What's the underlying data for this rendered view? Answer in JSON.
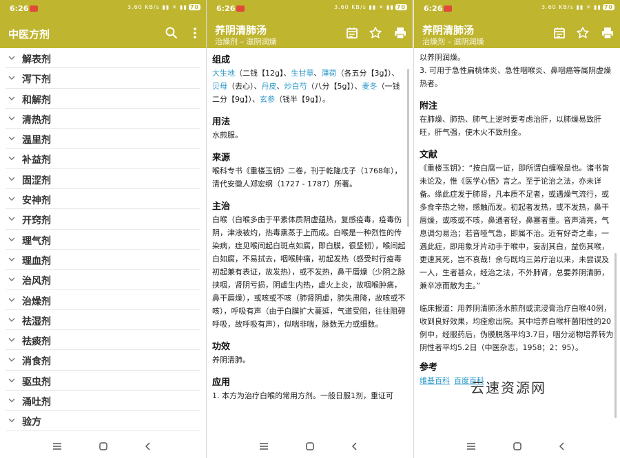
{
  "status": {
    "time": "6:26",
    "signal": "3.60 KB/s ▮▮ ✕ ▮▮",
    "battery": "70"
  },
  "screen1": {
    "title": "中医方剂",
    "categories": [
      "解表剂",
      "泻下剂",
      "和解剂",
      "清热剂",
      "温里剂",
      "补益剂",
      "固涩剂",
      "安神剂",
      "开窍剂",
      "理气剂",
      "理血剂",
      "治风剂",
      "治燥剂",
      "祛湿剂",
      "祛痰剂",
      "消食剂",
      "驱虫剂",
      "涌吐剂",
      "验方"
    ]
  },
  "screen2": {
    "title": "养阴清肺汤",
    "subtitle": "治燥剂 – 滋阴润燥",
    "sections": {
      "zucheng_h": "组成",
      "z1a": "大生地",
      "z1b": "（二钱【12g】、",
      "z1c": "生甘草",
      "z1d": "、",
      "z1e": "薄荷",
      "z1f": "（各五分【3g】）、",
      "z2a": "贝母",
      "z2b": "（去心）、",
      "z2c": "丹皮",
      "z2d": "、",
      "z2e": "炒白芍",
      "z2f": "（八分【5g】）、",
      "z2g": "麦冬",
      "z2h": "（一钱二分【9g】）、",
      "z2i": "玄参",
      "z2j": "（钱半【9g】）。",
      "yongfa_h": "用法",
      "yongfa": "水煎服。",
      "laiyuan_h": "来源",
      "laiyuan": "喉科专书《重楼玉钥》二卷，刊于乾隆戊子（1768年），清代安徽人郑宏纲（1727 - 1787）所著。",
      "zhuzhi_h": "主治",
      "zhuzhi": "白喉（白喉多由于平素体质阴虚蕴热，复感疫毒，疫毒伤阴，津液被灼，热毒熏蒸于上而成。白喉是一种烈性的传染病，症见喉间起白斑点如腐，即白膜，很坚韧），喉间起白如腐，不易拭去，咽喉肿痛，初起发热（感受时行疫毒初起兼有表证，故发热），或不发热，鼻干唇燥（少阴之脉挟咽，肾阴亏损，阴虚生内热，虚火上炎，故咽喉肿痛，鼻干唇燥），或咳或不咳（肺肾阴虚，肺失肃降，故咳或不咳），呼吸有声（由于白膜扩大蔓延，气道受阻，往往阻碍呼吸，故呼吸有声），似喘非喘，脉数无力或细数。",
      "gongxiao_h": "功效",
      "gongxiao": "养阴清肺。",
      "yingyong_h": "应用",
      "yingyong": "1. 本方为治疗白喉的常用方剂。一般日服1剂，重证可"
    }
  },
  "screen3": {
    "title": "养阴清肺汤",
    "subtitle": "治燥剂 – 滋阴润燥",
    "top1": "以养阴润燥。",
    "top2": "3. 可用于急性扁桃体炎、急性咽喉炎、鼻咽癌等属阴虚燥热者。",
    "fuzhu_h": "附注",
    "fuzhu": "在肺燥、肺热、肺气上逆时要考虑治肝，以肺燥易致肝旺，肝气强，使木火不致刑金。",
    "wenxian_h": "文献",
    "wenxian": "《重楼玉钥》：“按白腐一证，即所谓白缠喉是也。诸书皆未论及，惟《医学心悟》言之。至于论治之法，亦未详备。缘此症发于肺肾，凡本质不足者，或遇燥气流行，或多食辛热之物，感触而发。初起者发热，或不发热，鼻干唇燥，或咳或不咳，鼻通者轻，鼻塞者重。音声清亮，气息调匀易治；若音哑气急，即属不治。近有好奇之辈，一遇此症，即用象牙片动手于喉中，妄刮其白，益伤其喉，更速其死，岂不哀哉！余与既均三弟疗治以来，未尝误及一人，生者甚众，经治之法，不外肺肾，总要养阴清肺，兼辛凉而散为主。”",
    "clinical": "临床报道：用养阴清肺汤水煎剂或流浸膏治疗白喉40例，收到良好效果，均痊愈出院。其中培养白喉杆菌阳性的20例中，经服药后，伪膜脱落平均3.7日，咽分泌物培养转为阴性者平均5.2日（中医杂志，1958；2：95）。",
    "ref_h": "参考",
    "link1": "维基百科",
    "link2": "百度百科",
    "watermark": "云速资源网"
  },
  "icons": [
    "search-icon",
    "more-icon",
    "calendar-icon",
    "star-icon",
    "print-icon",
    "chevron-down-icon",
    "menu-icon",
    "home-icon",
    "back-icon"
  ]
}
